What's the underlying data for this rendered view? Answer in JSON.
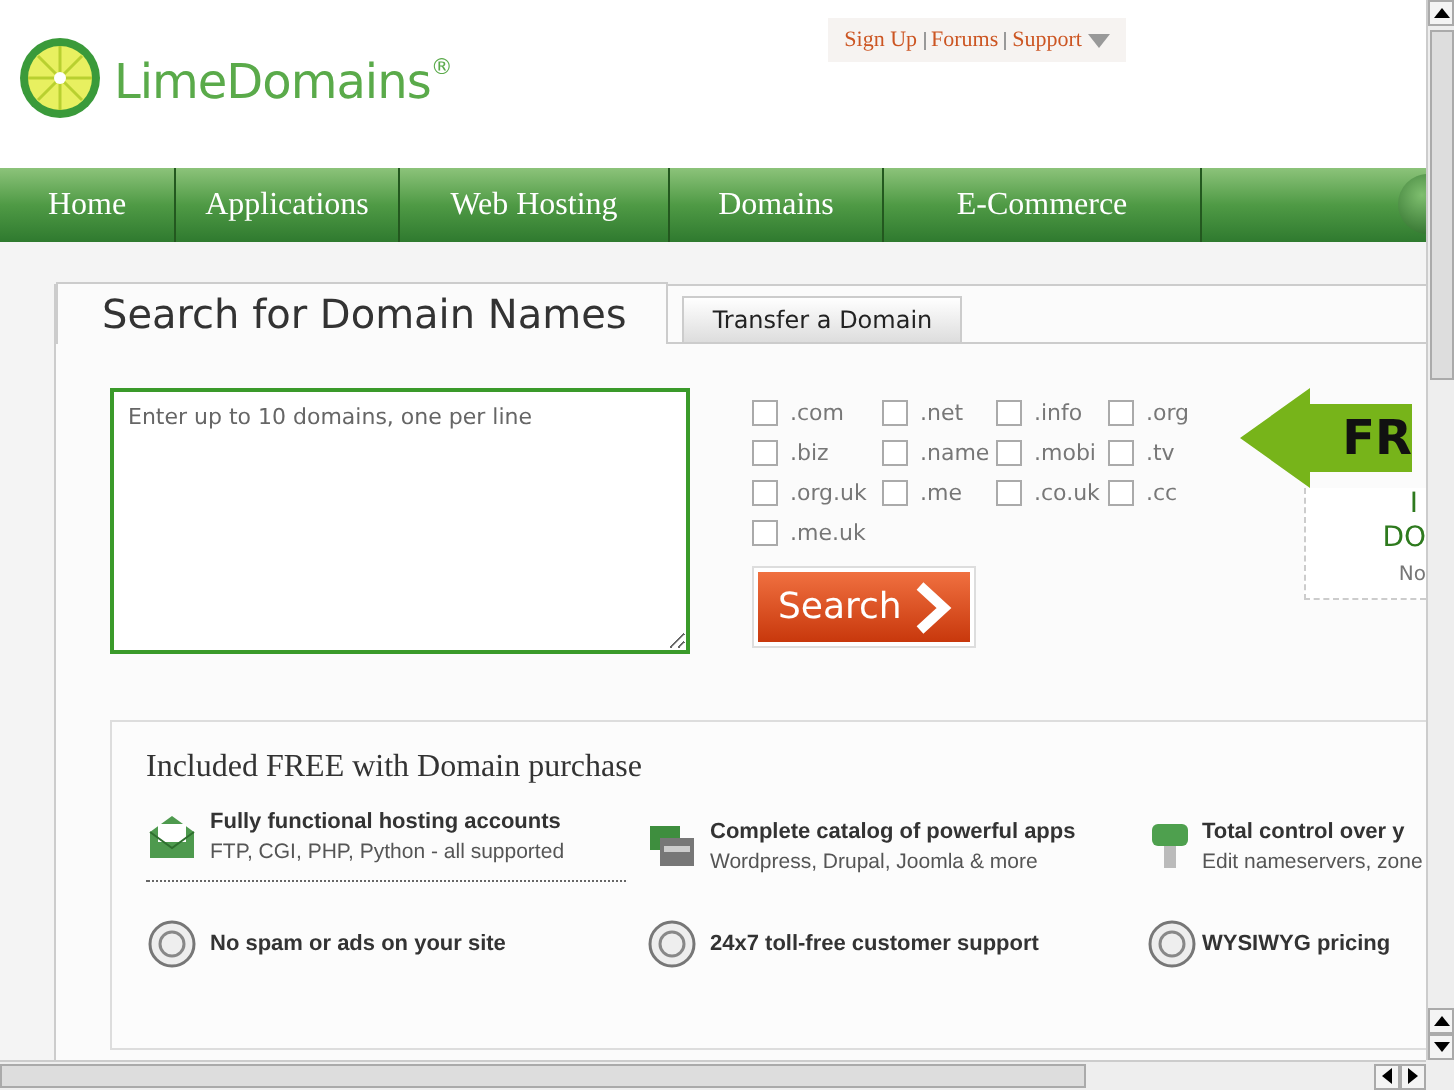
{
  "header": {
    "logo": "LimeDomains",
    "registered_mark": "®",
    "top_links": [
      {
        "label": "Sign Up"
      },
      {
        "label": "Forums"
      },
      {
        "label": "Support"
      }
    ]
  },
  "nav": [
    {
      "label": "Home"
    },
    {
      "label": "Applications"
    },
    {
      "label": "Web Hosting"
    },
    {
      "label": "Domains"
    },
    {
      "label": "E-Commerce"
    }
  ],
  "search_panel": {
    "tabs": [
      {
        "label": "Search for Domain Names",
        "selected": true
      },
      {
        "label": "Transfer a Domain",
        "selected": false
      }
    ],
    "domains_field": {
      "placeholder": "Enter up to 10 domains, one per line"
    },
    "extensions": [
      {
        "label": ".com",
        "checked": false
      },
      {
        "label": ".net",
        "checked": false
      },
      {
        "label": ".info",
        "checked": false
      },
      {
        "label": ".org",
        "checked": false
      },
      {
        "label": ".biz",
        "checked": false
      },
      {
        "label": ".name",
        "checked": false
      },
      {
        "label": ".mobi",
        "checked": false
      },
      {
        "label": ".tv",
        "checked": false
      },
      {
        "label": ".org.uk",
        "checked": false
      },
      {
        "label": ".me",
        "checked": false
      },
      {
        "label": ".co.uk",
        "checked": false
      },
      {
        "label": ".cc",
        "checked": false
      },
      {
        "label": ".me.uk",
        "checked": false
      }
    ],
    "search_button": "Search",
    "promo": {
      "banner": "FR",
      "lines": [
        "I",
        "DO"
      ],
      "note": "No"
    }
  },
  "features": {
    "title": "Included FREE with Domain purchase",
    "items": [
      {
        "kind": "detailed",
        "title": "Fully functional hosting accounts",
        "subtitle": "FTP, CGI, PHP, Python - all supported"
      },
      {
        "kind": "detailed",
        "title": "Complete catalog of powerful apps",
        "subtitle": "Wordpress, Drupal, Joomla & more"
      },
      {
        "kind": "detailed",
        "title": "Total control over y",
        "subtitle": "Edit nameservers, zone"
      },
      {
        "kind": "simple",
        "title": "No spam or ads on your site"
      },
      {
        "kind": "simple",
        "title": "24x7 toll-free customer support"
      },
      {
        "kind": "simple",
        "title": "WYSIWYG pricing"
      }
    ]
  }
}
